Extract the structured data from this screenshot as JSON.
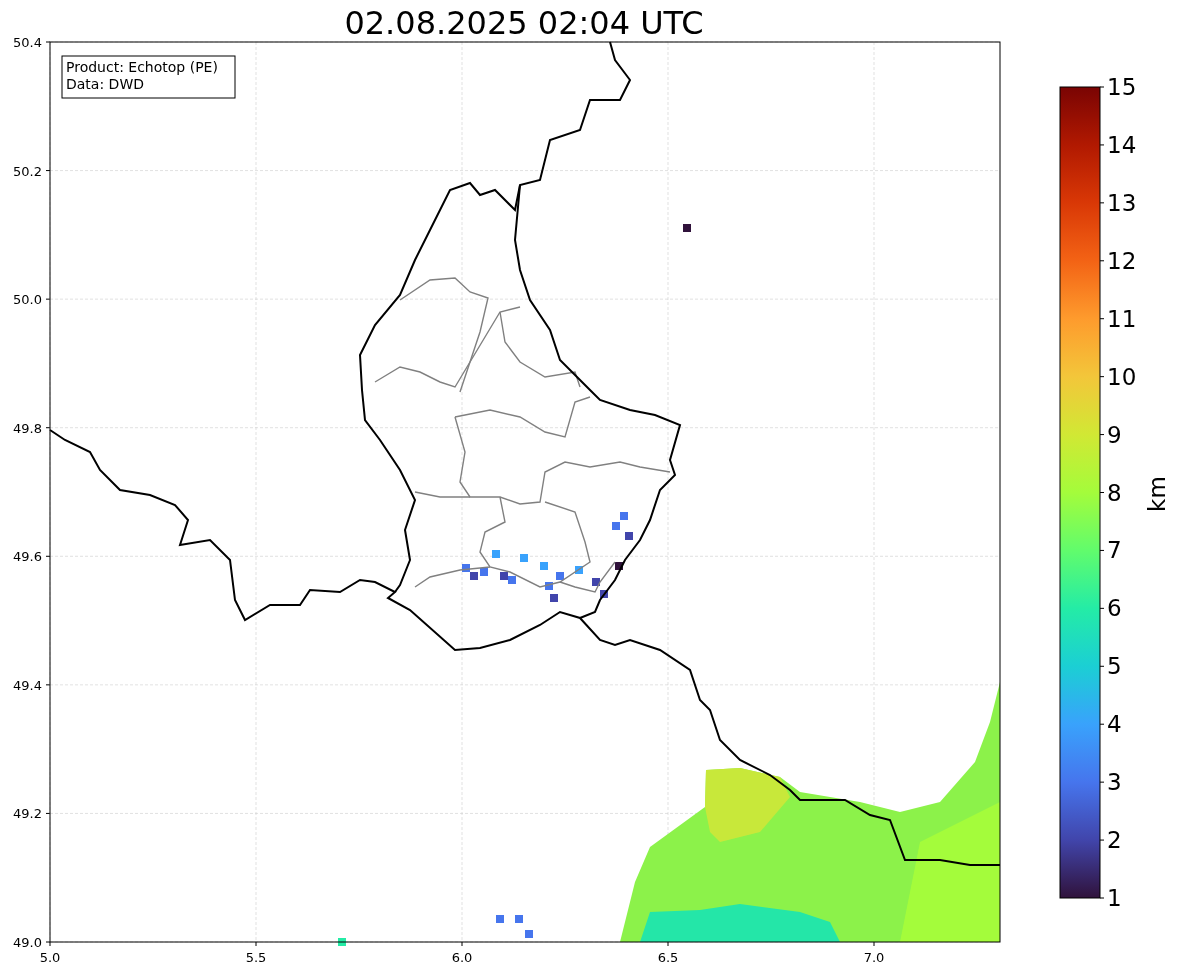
{
  "title": "02.08.2025 02:04 UTC",
  "info_box": {
    "lines": [
      "Product: Echotop (PE)",
      "Data: DWD"
    ]
  },
  "map": {
    "x_ticks": [
      "5.0",
      "5.5",
      "6.0",
      "6.5",
      "7.0"
    ],
    "y_ticks": [
      "50.4",
      "50.2",
      "50.0",
      "49.8",
      "49.6",
      "49.4",
      "49.2",
      "49.0"
    ]
  },
  "colorbar": {
    "ticks": [
      "15",
      "14",
      "13",
      "12",
      "11",
      "10",
      "9",
      "8",
      "7",
      "6",
      "5",
      "4",
      "3",
      "2",
      "1"
    ],
    "label": "km"
  }
}
